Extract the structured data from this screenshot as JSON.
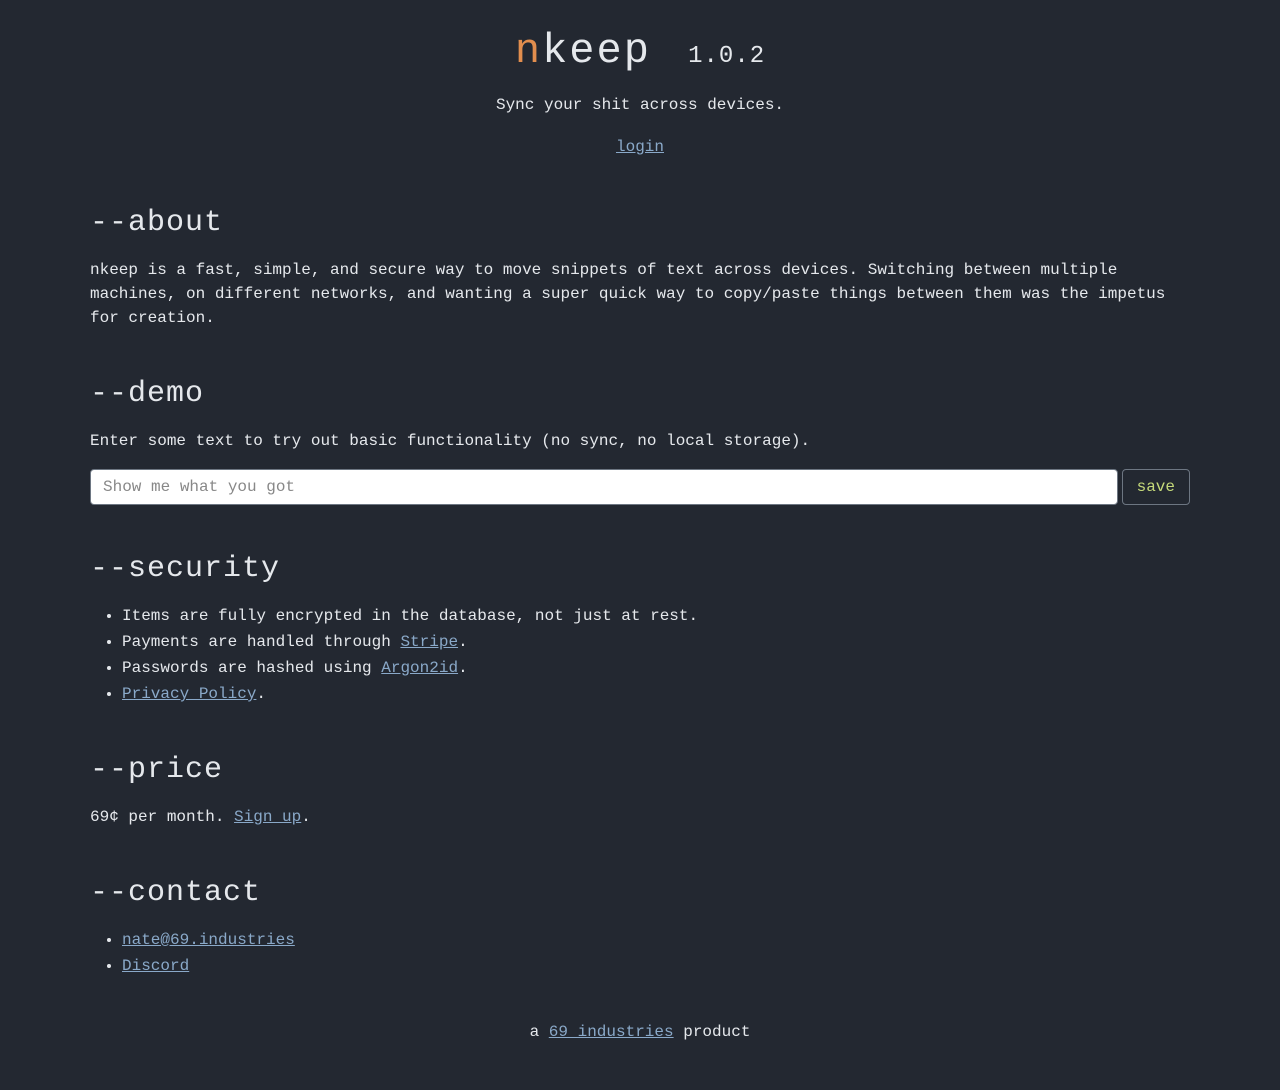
{
  "header": {
    "logo_n": "n",
    "logo_keep": "keep",
    "version": "1.0.2",
    "tagline": "Sync your shit across devices.",
    "login": "login"
  },
  "about": {
    "heading": "--about",
    "body": "nkeep is a fast, simple, and secure way to move snippets of text across devices. Switching between multiple machines, on different networks, and wanting a super quick way to copy/paste things between them was the impetus for creation."
  },
  "demo": {
    "heading": "--demo",
    "body": "Enter some text to try out basic functionality (no sync, no local storage).",
    "placeholder": "Show me what you got",
    "save_label": "save"
  },
  "security": {
    "heading": "--security",
    "item1": "Items are fully encrypted in the database, not just at rest.",
    "item2_pre": "Payments are handled through ",
    "item2_link": "Stripe",
    "item3_pre": "Passwords are hashed using ",
    "item3_link": "Argon2id",
    "item4_link": "Privacy Policy",
    "dot": "."
  },
  "price": {
    "heading": "--price",
    "body_pre": "69¢ per month. ",
    "signup": "Sign up",
    "dot": "."
  },
  "contact": {
    "heading": "--contact",
    "email": "nate@69.industries",
    "discord": "Discord"
  },
  "footer": {
    "pre": "a ",
    "link": "69 industries",
    "post": " product"
  }
}
